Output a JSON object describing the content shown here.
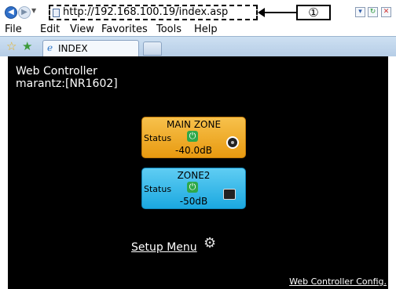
{
  "browser": {
    "address_url": "http://192.168.100.19/index.asp",
    "callout_number": "①",
    "menu": [
      "File",
      "Edit",
      "View",
      "Favorites",
      "Tools",
      "Help"
    ],
    "tab_title": "INDEX",
    "icons": {
      "back": "back-arrow-icon",
      "forward": "forward-arrow-icon",
      "go": "go-refresh-icon",
      "stop": "stop-x-icon",
      "favorites": "favorites-star-icon",
      "add_favorites": "add-favorites-star-icon",
      "tab": "ie-tab-icon"
    }
  },
  "page": {
    "title": "Web Controller",
    "device": "marantz:[NR1602]",
    "zones": [
      {
        "name": "MAIN ZONE",
        "status_label": "Status",
        "volume": "-40.0dB",
        "color": "#f0a82a"
      },
      {
        "name": "ZONE2",
        "status_label": "Status",
        "volume": "-50dB",
        "color": "#2bb4e8"
      }
    ],
    "setup_menu": "Setup Menu",
    "config_link": "Web Controller Config.",
    "background": "#000000"
  }
}
